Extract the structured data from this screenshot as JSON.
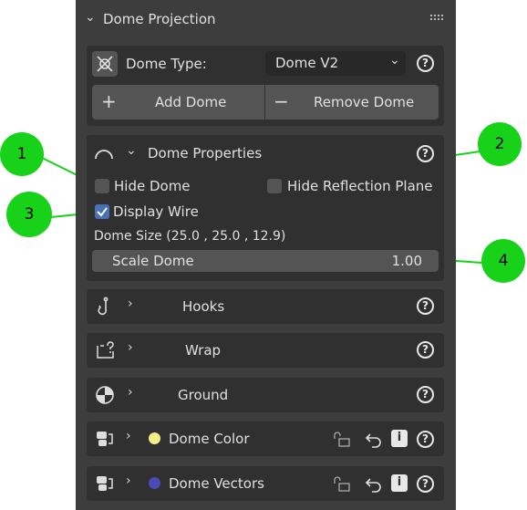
{
  "panel": {
    "title": "Dome Projection",
    "grip_icon": "grip-dots-icon"
  },
  "dome_type": {
    "label": "Dome Type:",
    "value": "Dome V2"
  },
  "buttons": {
    "add": "Add Dome",
    "remove": "Remove Dome",
    "add_symbol": "+",
    "remove_symbol": "−"
  },
  "dome_properties": {
    "title": "Dome Properties",
    "hide_dome": {
      "label": "Hide Dome",
      "checked": false
    },
    "hide_reflection": {
      "label": "Hide Reflection Plane",
      "checked": false
    },
    "display_wire": {
      "label": "Display Wire",
      "checked": true
    },
    "dome_size": "Dome Size (25.0 , 25.0 , 12.9)",
    "scale": {
      "label": "Scale Dome",
      "value": "1.00"
    }
  },
  "sections": [
    {
      "label": "Hooks",
      "icon": "hook-icon"
    },
    {
      "label": "Wrap",
      "icon": "wrap-icon"
    },
    {
      "label": "Ground",
      "icon": "ground-icon"
    },
    {
      "label": "Dome Color",
      "icon": "dome-color-icon",
      "dot_color": "#f4ef87"
    },
    {
      "label": "Dome Vectors",
      "icon": "dome-vectors-icon",
      "dot_color": "#4b49b3"
    }
  ],
  "help_symbol": "?",
  "info_symbol": "i",
  "callouts": [
    "1",
    "2",
    "3",
    "4"
  ],
  "colors": {
    "panel": "#3d3d3d",
    "subpanel": "#303030",
    "button": "#545454",
    "check_on": "#4772b3",
    "callout": "#18d21a"
  }
}
